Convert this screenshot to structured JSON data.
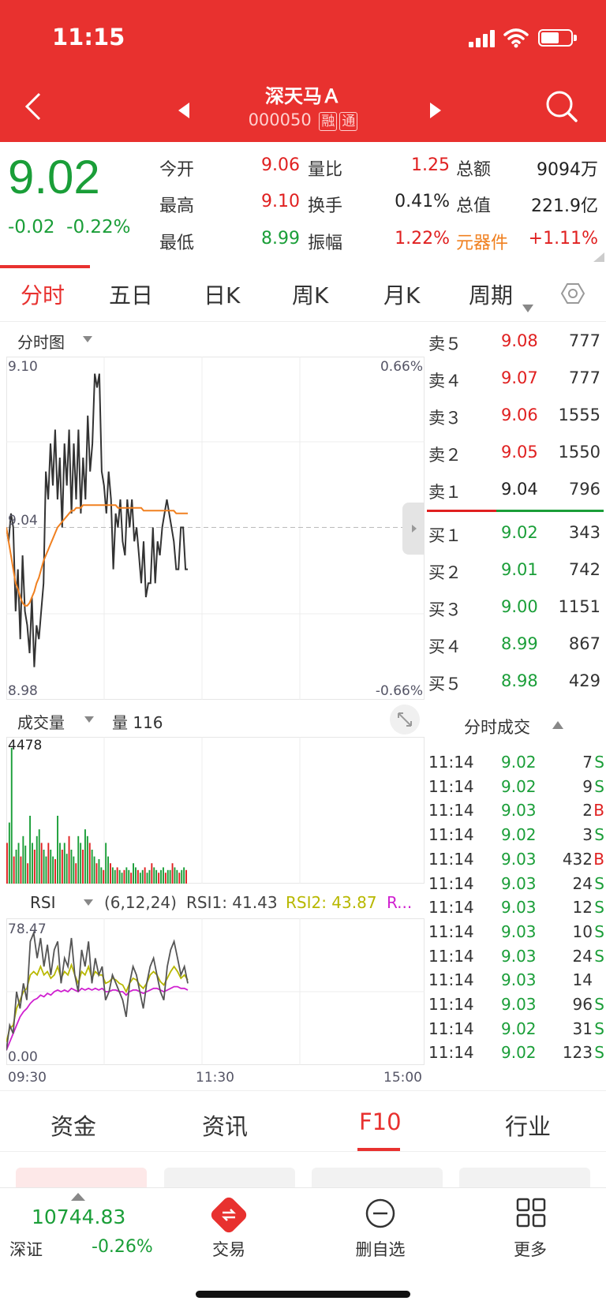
{
  "status": {
    "time": "11:15"
  },
  "header": {
    "title": "深天马Ａ",
    "code": "000050",
    "tag1": "融",
    "tag2": "通"
  },
  "quote": {
    "price": "9.02",
    "change": "-0.02",
    "change_pct": "-0.22%",
    "open_label": "今开",
    "open": "9.06",
    "vr_label": "量比",
    "vr": "1.25",
    "amt_label": "总额",
    "amt": "9094万",
    "high_label": "最高",
    "high": "9.10",
    "turn_label": "换手",
    "turn": "0.41%",
    "mcap_label": "总值",
    "mcap": "221.9亿",
    "low_label": "最低",
    "low": "8.99",
    "amp_label": "振幅",
    "amp": "1.22%",
    "sector": "元器件",
    "sector_pct": "+1.11%"
  },
  "tabs": [
    "分时",
    "五日",
    "日K",
    "周K",
    "月K",
    "周期"
  ],
  "intraday": {
    "label": "分时图",
    "top_price": "9.10",
    "mid_price": "9.04",
    "bottom_price": "8.98",
    "top_pct": "0.66%",
    "bottom_pct": "-0.66%",
    "price_series": [
      9.04,
      9.035,
      9.045,
      9.04,
      9.01,
      9.025,
      9.0,
      9.03,
      9.01,
      9.005,
      8.995,
      9.015,
      8.99,
      9.005,
      9.0,
      9.01,
      9.02,
      9.06,
      9.05,
      9.07,
      9.055,
      9.075,
      9.05,
      9.065,
      9.04,
      9.07,
      9.055,
      9.075,
      9.045,
      9.07,
      9.05,
      9.075,
      9.045,
      9.065,
      9.05,
      9.08,
      9.06,
      9.07,
      9.095,
      9.09,
      9.095,
      9.06,
      9.055,
      9.045,
      9.06,
      9.05,
      9.025,
      9.045,
      9.04,
      9.05,
      9.035,
      9.03,
      9.05,
      9.04,
      9.05,
      9.035,
      9.04,
      9.03,
      9.02,
      9.035,
      9.015,
      9.02,
      9.02,
      9.04,
      9.02,
      9.035,
      9.03,
      9.04,
      9.045,
      9.05,
      9.045,
      9.04,
      9.035,
      9.025,
      9.025,
      9.04,
      9.04,
      9.025,
      9.025
    ],
    "avg_series": [
      9.04,
      9.035,
      9.03,
      9.025,
      9.02,
      9.018,
      9.015,
      9.013,
      9.012,
      9.012,
      9.013,
      9.015,
      9.017,
      9.02,
      9.022,
      9.025,
      9.028,
      9.03,
      9.032,
      9.034,
      9.036,
      9.038,
      9.04,
      9.041,
      9.042,
      9.043,
      9.044,
      9.045,
      9.046,
      9.046,
      9.047,
      9.047,
      9.047,
      9.048,
      9.048,
      9.048,
      9.048,
      9.048,
      9.048,
      9.048,
      9.048,
      9.048,
      9.048,
      9.048,
      9.048,
      9.048,
      9.048,
      9.048,
      9.047,
      9.047,
      9.047,
      9.047,
      9.047,
      9.047,
      9.047,
      9.047,
      9.047,
      9.047,
      9.047,
      9.046,
      9.046,
      9.046,
      9.046,
      9.046,
      9.046,
      9.046,
      9.046,
      9.046,
      9.046,
      9.046,
      9.046,
      9.046,
      9.046,
      9.045,
      9.045,
      9.045,
      9.045,
      9.045,
      9.045
    ],
    "x_ticks": [
      "09:30",
      "11:30",
      "15:00"
    ]
  },
  "volume": {
    "label": "成交量",
    "vol_label": "量",
    "vol_value": "116",
    "max": "4478",
    "bars": [
      0.3,
      0.45,
      1.0,
      0.2,
      0.25,
      0.3,
      0.2,
      0.35,
      0.28,
      0.15,
      0.5,
      0.3,
      0.25,
      0.35,
      0.4,
      0.3,
      0.25,
      0.2,
      0.3,
      0.25,
      0.2,
      0.18,
      0.5,
      0.3,
      0.25,
      0.3,
      0.22,
      0.35,
      0.25,
      0.2,
      0.15,
      0.35,
      0.3,
      0.25,
      0.4,
      0.35,
      0.3,
      0.25,
      0.2,
      0.15,
      0.18,
      0.12,
      0.1,
      0.3,
      0.2,
      0.15,
      0.12,
      0.1,
      0.12,
      0.1,
      0.08,
      0.1,
      0.12,
      0.1,
      0.08,
      0.15,
      0.12,
      0.1,
      0.08,
      0.1,
      0.12,
      0.08,
      0.1,
      0.15,
      0.12,
      0.1,
      0.08,
      0.1,
      0.12,
      0.08,
      0.1,
      0.1,
      0.15,
      0.12,
      0.1,
      0.08,
      0.1,
      0.12,
      0.1
    ],
    "bar_colors": "mixed"
  },
  "rsi": {
    "label": "RSI",
    "params": "(6,12,24)",
    "rsi1": "RSI1: 41.43",
    "rsi2": "RSI2: 43.87",
    "rsi3": "R...",
    "top": "78.47",
    "bottom": "0.00",
    "rsi1_series": [
      5,
      20,
      15,
      40,
      30,
      45,
      35,
      70,
      75,
      60,
      72,
      55,
      68,
      50,
      65,
      70,
      45,
      60,
      55,
      72,
      50,
      40,
      65,
      55,
      70,
      45,
      60,
      50,
      55,
      35,
      40,
      50,
      45,
      40,
      35,
      25,
      45,
      55,
      50,
      40,
      30,
      45,
      55,
      60,
      50,
      40,
      35,
      55,
      65,
      70,
      60,
      50,
      55,
      45
    ],
    "rsi2_series": [
      10,
      18,
      20,
      30,
      35,
      40,
      42,
      50,
      52,
      50,
      55,
      50,
      52,
      48,
      50,
      55,
      48,
      52,
      50,
      56,
      50,
      45,
      52,
      50,
      55,
      48,
      52,
      50,
      50,
      45,
      46,
      48,
      47,
      45,
      44,
      40,
      45,
      48,
      47,
      44,
      42,
      45,
      50,
      52,
      50,
      46,
      44,
      48,
      52,
      55,
      52,
      48,
      50,
      47
    ],
    "rsi3_series": [
      5,
      10,
      15,
      20,
      25,
      28,
      30,
      33,
      35,
      36,
      38,
      37,
      39,
      38,
      40,
      41,
      40,
      41,
      40,
      42,
      41,
      40,
      42,
      41,
      42,
      41,
      42,
      41,
      42,
      40,
      40,
      41,
      41,
      40,
      40,
      38,
      40,
      41,
      41,
      40,
      39,
      40,
      41,
      42,
      42,
      41,
      40,
      41,
      42,
      43,
      43,
      42,
      42,
      41
    ]
  },
  "orderbook": {
    "asks": [
      {
        "label": "卖５",
        "price": "9.08",
        "vol": "777"
      },
      {
        "label": "卖４",
        "price": "9.07",
        "vol": "777"
      },
      {
        "label": "卖３",
        "price": "9.06",
        "vol": "1555"
      },
      {
        "label": "卖２",
        "price": "9.05",
        "vol": "1550"
      },
      {
        "label": "卖１",
        "price": "9.04",
        "vol": "796"
      }
    ],
    "bids": [
      {
        "label": "买１",
        "price": "9.02",
        "vol": "343"
      },
      {
        "label": "买２",
        "price": "9.01",
        "vol": "742"
      },
      {
        "label": "买３",
        "price": "9.00",
        "vol": "1151"
      },
      {
        "label": "买４",
        "price": "8.99",
        "vol": "867"
      },
      {
        "label": "买５",
        "price": "8.98",
        "vol": "429"
      }
    ]
  },
  "trades": {
    "label": "分时成交",
    "rows": [
      {
        "time": "11:14",
        "price": "9.02",
        "vol": "7",
        "side": "S"
      },
      {
        "time": "11:14",
        "price": "9.02",
        "vol": "9",
        "side": "S"
      },
      {
        "time": "11:14",
        "price": "9.03",
        "vol": "2",
        "side": "B"
      },
      {
        "time": "11:14",
        "price": "9.02",
        "vol": "3",
        "side": "S"
      },
      {
        "time": "11:14",
        "price": "9.03",
        "vol": "432",
        "side": "B"
      },
      {
        "time": "11:14",
        "price": "9.03",
        "vol": "24",
        "side": "S"
      },
      {
        "time": "11:14",
        "price": "9.03",
        "vol": "12",
        "side": "S"
      },
      {
        "time": "11:14",
        "price": "9.03",
        "vol": "10",
        "side": "S"
      },
      {
        "time": "11:14",
        "price": "9.03",
        "vol": "24",
        "side": "S"
      },
      {
        "time": "11:14",
        "price": "9.03",
        "vol": "14",
        "side": ""
      },
      {
        "time": "11:14",
        "price": "9.03",
        "vol": "96",
        "side": "S"
      },
      {
        "time": "11:14",
        "price": "9.02",
        "vol": "31",
        "side": "S"
      },
      {
        "time": "11:14",
        "price": "9.02",
        "vol": "123",
        "side": "S"
      }
    ]
  },
  "sections": [
    "资金",
    "资讯",
    "F10",
    "行业"
  ],
  "bottom": {
    "index_value": "10744.83",
    "index_name": "深证",
    "index_pct": "-0.26%",
    "trade": "交易",
    "remove": "删自选",
    "more": "更多"
  },
  "colors": {
    "up": "#e02020",
    "down": "#1a9e38",
    "brand": "#e8312f",
    "avg_line": "#f08020"
  }
}
